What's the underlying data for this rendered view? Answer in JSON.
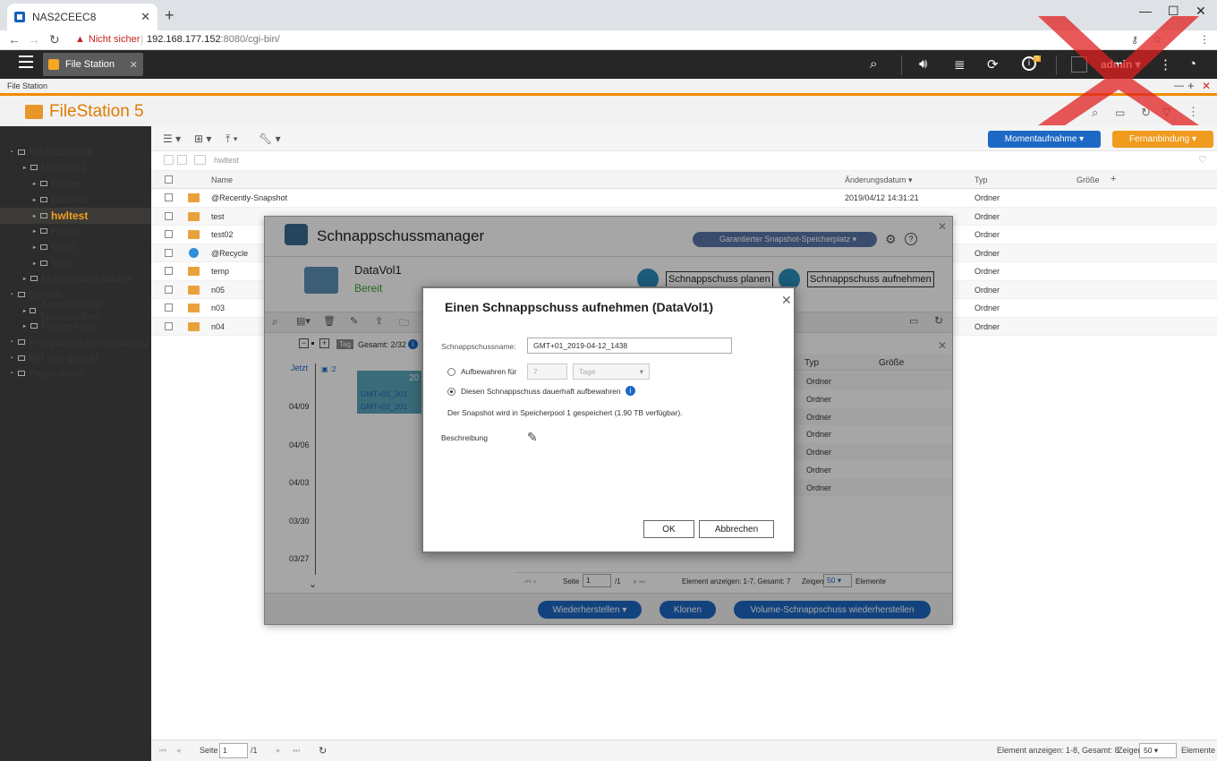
{
  "browser": {
    "tab_title": "NAS2CEEC8",
    "tab_close": "✕",
    "new_tab": "+",
    "win_min": "—",
    "win_max": "☐",
    "win_close": "✕",
    "security_label": "Nicht sicher",
    "url_host": "192.168.177.152",
    "url_rest": ":8080/cgi-bin/"
  },
  "qts": {
    "app_tab_label": "File Station",
    "app_tab_close": "✕",
    "user": "admin ▾",
    "notification_count": "5"
  },
  "app": {
    "strip_title": "File Station",
    "title": "FileStation 5",
    "snapshot_button": "Momentaufnahme ▾",
    "remote_button": "Fernanbindung ▾",
    "path": "hwltest"
  },
  "sidebar": {
    "items": [
      {
        "label": "NAS2CEEC8",
        "indent": 1
      },
      {
        "label": "DataVol1",
        "indent": 2
      },
      {
        "label": "home",
        "indent": 3
      },
      {
        "label": "homes",
        "indent": 3
      },
      {
        "label": "hwltest",
        "indent": 3,
        "selected": true
      },
      {
        "label": "Public",
        "indent": 3
      },
      {
        "label": "test2",
        "indent": 3
      },
      {
        "label": "Web",
        "indent": 3
      },
      {
        "label": "Momentaufnahme",
        "indent": 2
      },
      {
        "label": "Qsync",
        "indent": 1
      },
      {
        "label": "Akzeptierter Teamordner",
        "indent": 2
      },
      {
        "label": "Papierkorb",
        "indent": 2
      },
      {
        "label": "Freigabelinkverwaltung",
        "indent": 1
      },
      {
        "label": "Mit mir geteilt",
        "indent": 1
      },
      {
        "label": "Papierkorb",
        "indent": 1
      }
    ]
  },
  "file_table": {
    "headers": {
      "name": "Name",
      "date": "Änderungsdatum ▾",
      "type": "Typ",
      "size": "Größe"
    },
    "rows": [
      {
        "name": "@Recently-Snapshot",
        "date": "2019/04/12 14:31:21",
        "type": "Ordner"
      },
      {
        "name": "test",
        "date": "",
        "type": "Ordner"
      },
      {
        "name": "test02",
        "date": "",
        "type": "Ordner"
      },
      {
        "name": "@Recycle",
        "date": "",
        "type": "Ordner"
      },
      {
        "name": "temp",
        "date": "",
        "type": "Ordner"
      },
      {
        "name": "n05",
        "date": "",
        "type": "Ordner"
      },
      {
        "name": "n03",
        "date": "",
        "type": "Ordner"
      },
      {
        "name": "n04",
        "date": "",
        "type": "Ordner"
      }
    ]
  },
  "statusbar": {
    "page_label": "Seite",
    "page_value": "1",
    "page_total": "/1",
    "items_info": "Element anzeigen: 1-8, Gesamt: 8",
    "show_label": "Zeigen",
    "show_value": "50",
    "items_label": "Elemente"
  },
  "snapshot_manager": {
    "title": "Schnappschussmanager",
    "pool_badge": "Garantierter Snapshot-Speicherplatz ▾",
    "volume_name": "DataVol1",
    "volume_status": "Bereit",
    "plan_button": "Schnappschuss planen",
    "take_button": "Schnappschuss aufnehmen",
    "tag_label": "Tag",
    "total_label": "Gesamt: 2/32",
    "now_label": "Jetzt",
    "snap_count": "2",
    "dates": [
      "04/09",
      "04/06",
      "04/03",
      "03/30",
      "03/27"
    ],
    "snap_items": [
      "GMT+01_201",
      "GMT+01_201"
    ],
    "timeline_header": "20",
    "col_type": "Typ",
    "col_size": "Größe",
    "type_rows": [
      "Ordner",
      "Ordner",
      "Ordner",
      "Ordner",
      "Ordner",
      "Ordner",
      "Ordner"
    ],
    "page_label": "Seite",
    "page_value": "1",
    "page_total": "/1",
    "items_info": "Element anzeigen: 1-7, Gesamt: 7",
    "show_label": "Zeigen",
    "show_value": "50",
    "items_label": "Elemente",
    "restore_button": "Wiederherstellen ▾",
    "clone_button": "Klonen",
    "volume_restore_button": "Volume-Schnappschuss wiederherstellen"
  },
  "dialog": {
    "title": "Einen Schnappschuss aufnehmen (DataVol1)",
    "name_label": "Schnappschussname:",
    "name_value": "GMT+01_2019-04-12_1438",
    "keep_for_label": "Aufbewahren für",
    "keep_for_value": "7",
    "keep_for_unit": "Tage",
    "keep_forever_label": "Diesen Schnappschuss dauerhaft aufbewahren",
    "storage_note": "Der Snapshot wird in Speicherpool 1 gespeichert (1.90 TB verfügbar).",
    "description_label": "Beschreibung",
    "ok_button": "OK",
    "cancel_button": "Abbrechen",
    "close": "✕"
  }
}
